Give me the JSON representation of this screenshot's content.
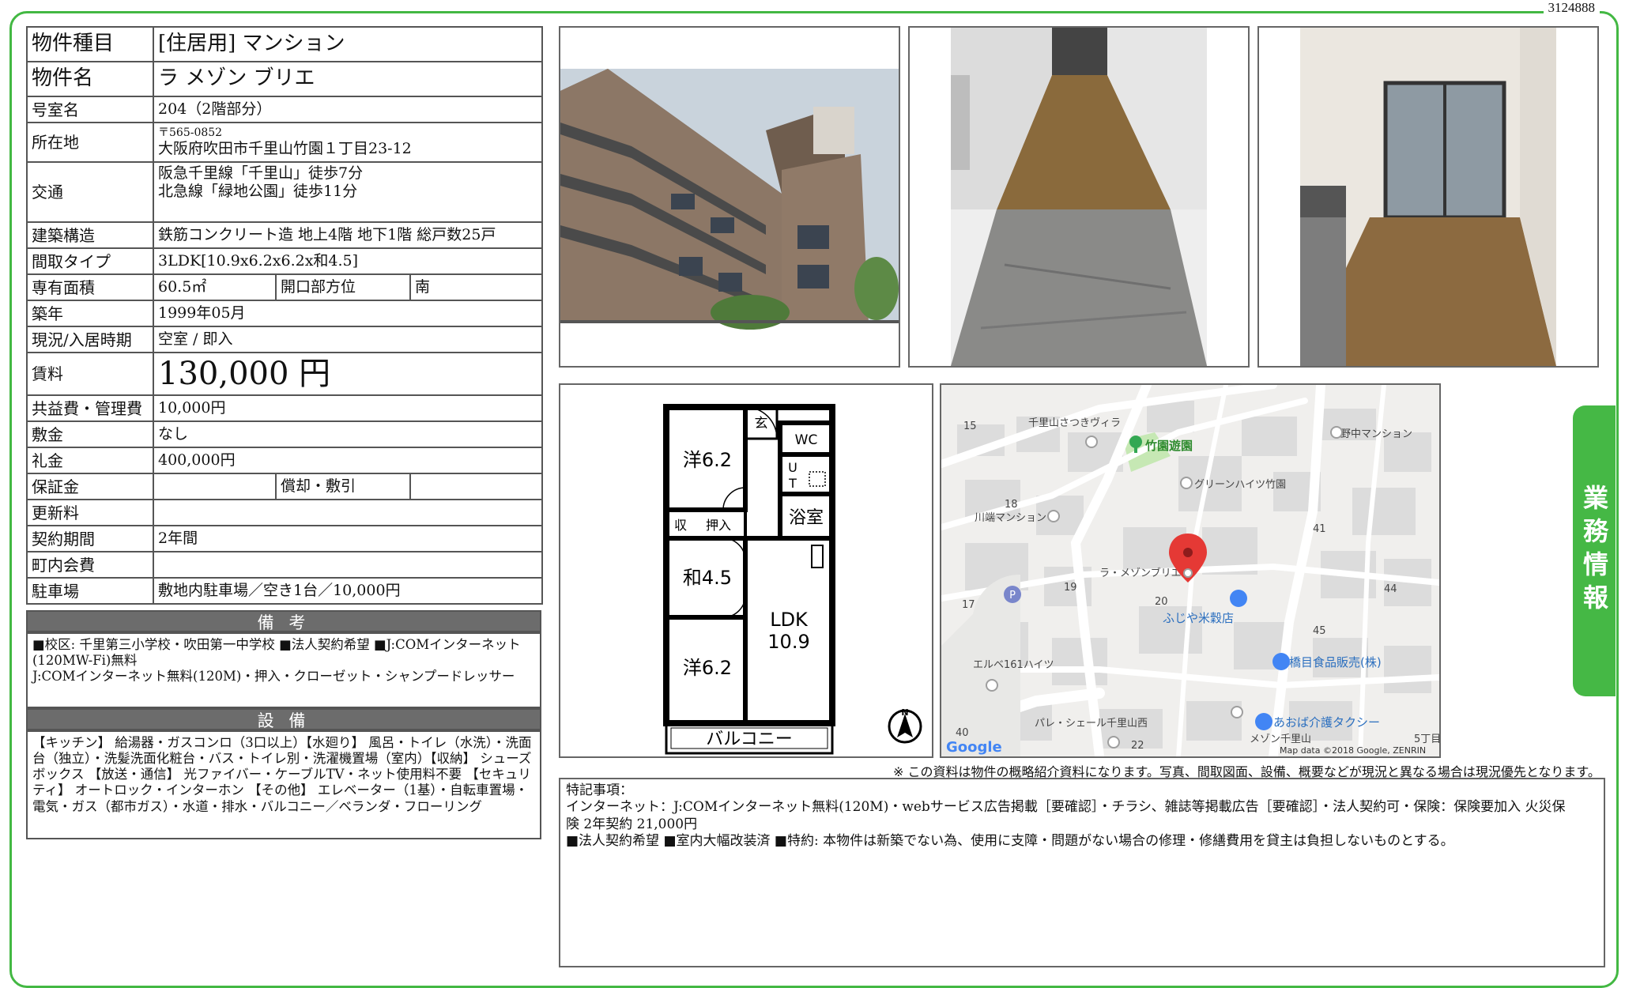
{
  "doc_id": "3124888",
  "side_tab": "業務情報",
  "spec": {
    "type_label": "物件種目",
    "type_value": "[住居用] マンション",
    "name_label": "物件名",
    "name_value": "ラ メゾン ブリエ",
    "room_label": "号室名",
    "room_value": "204（2階部分）",
    "address_label": "所在地",
    "postal": "〒565-0852",
    "address": "大阪府吹田市千里山竹園１丁目23-12",
    "transit_label": "交通",
    "transit_1": "阪急千里線「千里山」徒歩7分",
    "transit_2": "北急線「緑地公園」徒歩11分",
    "structure_label": "建築構造",
    "structure_value": "鉄筋コンクリート造 地上4階 地下1階 総戸数25戸",
    "layout_label": "間取タイプ",
    "layout_value": "3LDK[10.9x6.2x6.2x和4.5]",
    "area_label": "専有面積",
    "area_value": "60.5㎡",
    "direction_label": "開口部方位",
    "direction_value": "南",
    "built_label": "築年",
    "built_value": "1999年05月",
    "status_label": "現況/入居時期",
    "status_value": "空室 / 即入",
    "rent_label": "賃料",
    "rent_value": "130,000 円",
    "fee_label": "共益費・管理費",
    "fee_value": "10,000円",
    "deposit_label": "敷金",
    "deposit_value": "なし",
    "key_money_label": "礼金",
    "key_money_value": "400,000円",
    "guarantee_label": "保証金",
    "guarantee_value": "",
    "amort_label": "償却・敷引",
    "amort_value": "",
    "renewal_label": "更新料",
    "renewal_value": "",
    "contract_label": "契約期間",
    "contract_value": "2年間",
    "assoc_label": "町内会費",
    "assoc_value": "",
    "parking_label": "駐車場",
    "parking_value": "敷地内駐車場／空き1台／10,000円"
  },
  "remarks": {
    "title": "備 考",
    "text_1": "■校区: 千里第三小学校・吹田第一中学校 ■法人契約希望 ■J:COMインターネット(120MW-Fi)無料",
    "text_2": "J:COMインターネット無料(120M)・押入・クローゼット・シャンプードレッサー"
  },
  "facilities": {
    "title": "設 備",
    "text": "【キッチン】 給湯器・ガスコンロ（3口以上）【水廻り】 風呂・トイレ（水洗）・洗面台（独立）・洗髪洗面化粧台・バス・トイレ別・洗濯機置場（室内）【収納】 シューズボックス 【放送・通信】 光ファイバー・ケーブルTV・ネット使用料不要 【セキュリティ】 オートロック・インターホン 【その他】 エレベーター（1基）・自転車置場・電気・ガス（都市ガス）・水道・排水・バルコニー／ベランダ・フローリング"
  },
  "floorplan": {
    "room1": "洋6.2",
    "entrance": "玄",
    "wc": "WC",
    "ut_u": "U",
    "ut_t": "T",
    "bath": "浴室",
    "storage1": "収",
    "storage2": "押入",
    "room2": "和4.5",
    "ldk": "LDK",
    "ldk_size": "10.9",
    "room3": "洋6.2",
    "balcony": "バルコニー",
    "north": "N"
  },
  "map": {
    "labels": {
      "n15": "15",
      "villa": "千里山さつきヴィラ",
      "park": "竹園遊園",
      "nonaka": "野中マンション",
      "green": "グリーンハイツ竹園",
      "n18": "18",
      "kawabata": "川端マンション",
      "n41": "41",
      "property": "ラ・メゾンブリエ",
      "n19": "19",
      "n17": "17",
      "n20": "20",
      "n44": "44",
      "fujiya": "ふじや米穀店",
      "n45": "45",
      "hashime": "橋目食品販売(株)",
      "elbe": "エルベ161ハイツ",
      "palais": "パレ・シェール千里山西",
      "aoba": "あおば介護タクシー",
      "n40": "40",
      "n22": "22",
      "maison": "メゾン千里山",
      "chome": "5丁目"
    },
    "logo": "Google",
    "copyright": "Map data ©2018 Google, ZENRIN"
  },
  "notice": "※ この資料は物件の概略紹介資料になります。写真、間取図面、設備、概要などが現況と異なる場合は現況優先となります。",
  "notes": {
    "line_1": "特記事項：",
    "line_2": "インターネット：J:COMインターネット無料(120M)・webサービス広告掲載［要確認］・チラシ、雑誌等掲載広告［要確認］・法人契約可・保険：保険要加入 火災保",
    "line_3": "険 2年契約 21,000円",
    "line_4": "■法人契約希望 ■室内大幅改装済 ■特約: 本物件は新築でない為、使用に支障・問題がない場合の修理・修繕費用を貸主は負担しないものとする。"
  }
}
